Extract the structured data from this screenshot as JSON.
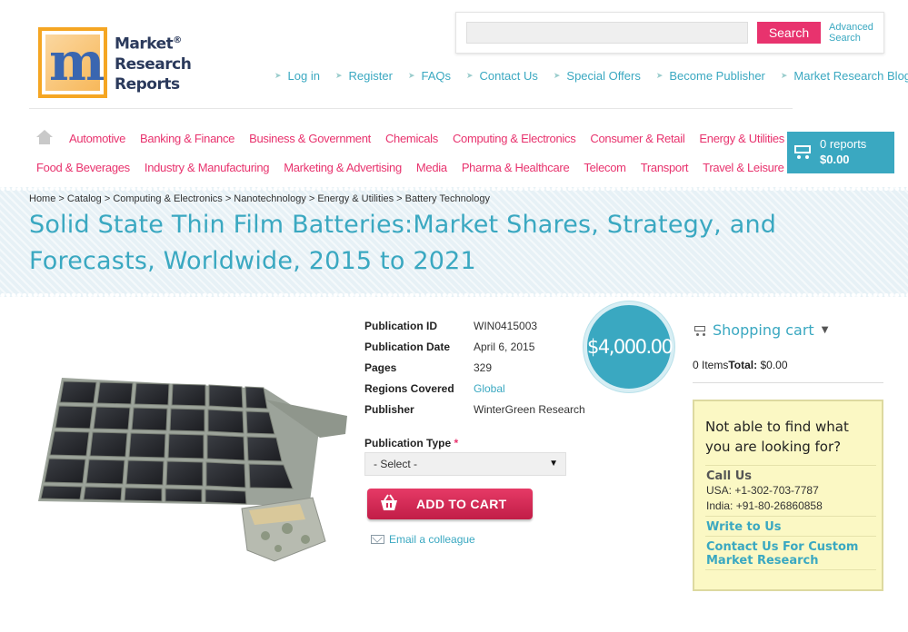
{
  "logo": {
    "mark": "m",
    "line1": "Market",
    "reg": "®",
    "line2": "Research",
    "line3": "Reports"
  },
  "search": {
    "placeholder": "",
    "button_label": "Search",
    "advanced_line1": "Advanced",
    "advanced_line2": "Search"
  },
  "top_links": [
    "Log in",
    "Register",
    "FAQs",
    "Contact Us",
    "Special Offers",
    "Become Publisher",
    "Market Research Blog"
  ],
  "categories_row1": [
    "Automotive",
    "Banking & Finance",
    "Business & Government",
    "Chemicals",
    "Computing & Electronics",
    "Consumer & Retail",
    "Energy & Utilities"
  ],
  "categories_row2": [
    "Food & Beverages",
    "Industry & Manufacturing",
    "Marketing & Advertising",
    "Media",
    "Pharma & Healthcare",
    "Telecom",
    "Transport",
    "Travel & Leisure"
  ],
  "cart": {
    "reports": "0 reports",
    "total": "$0.00"
  },
  "breadcrumb": "Home > Catalog > Computing & Electronics > Nanotechnology > Energy & Utilities > Battery Technology",
  "title": "Solid State Thin Film Batteries:Market Shares, Strategy, and Forecasts, Worldwide, 2015 to 2021",
  "details": [
    {
      "key": "Publication ID",
      "value": "WIN0415003"
    },
    {
      "key": "Publication Date",
      "value": "April 6, 2015"
    },
    {
      "key": "Pages",
      "value": "329"
    },
    {
      "key": "Regions Covered",
      "value": "Global"
    },
    {
      "key": "Publisher",
      "value": "WinterGreen Research"
    }
  ],
  "price": "$4,000.00",
  "pub_type": {
    "label": "Publication Type",
    "required_mark": "*",
    "selected": "- Select -"
  },
  "add_to_cart": "ADD TO CART",
  "email_colleague": "Email a colleague",
  "sidebar": {
    "shopping_cart": "Shopping cart",
    "items_count": "0 Items",
    "total_label": "Total:",
    "total_value": "$0.00",
    "help_title": "Not able to find what you are looking for?",
    "call_us": "Call Us",
    "phone_usa": "USA: +1-302-703-7787",
    "phone_india": "India: +91-80-26860858",
    "write_to_us": "Write to Us",
    "contact_custom": "Contact Us For Custom Market Research"
  },
  "colors": {
    "accent": "#3aa8c1",
    "brand_pink": "#e8336e",
    "help_bg": "#fbf8c4"
  }
}
